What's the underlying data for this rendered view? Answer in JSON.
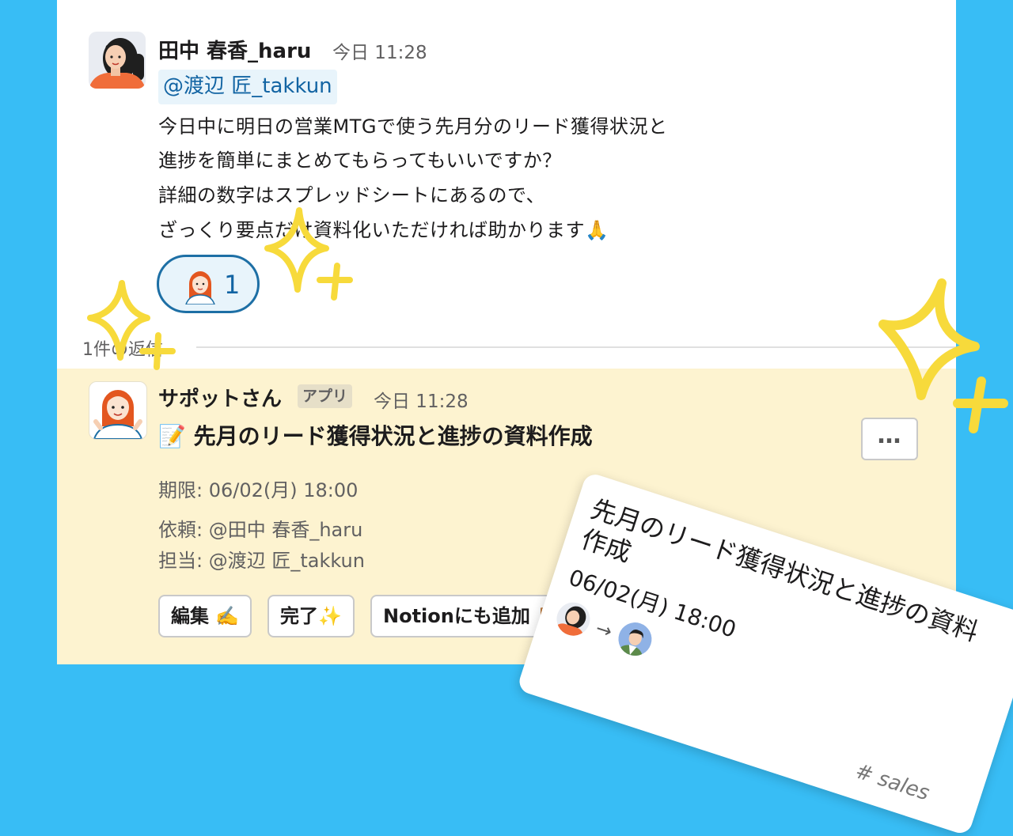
{
  "message": {
    "author": "田中 春香_haru",
    "time": "今日 11:28",
    "mention": "@渡辺 匠_takkun",
    "lines": [
      "今日中に明日の営業MTGで使う先月分のリード獲得状況と",
      "進捗を簡単にまとめてもらってもいいですか？",
      "詳細の数字はスプレッドシートにあるので、",
      "ざっくり要点だけ資料化いただければ助かります🙏"
    ],
    "reaction_count": "1"
  },
  "thread": {
    "replies_label": "1件の返信"
  },
  "bot": {
    "name": "サポットさん",
    "badge": "アプリ",
    "time": "今日 11:28",
    "title_icon": "📝",
    "title": "先月のリード獲得状況と進捗の資料作成",
    "deadline": "期限: 06/02(月) 18:00",
    "requester": "依頼: @田中 春香_haru",
    "assignee": "担当: @渡辺 匠_takkun",
    "more_label": "…",
    "buttons": {
      "edit": "編集 ✍️",
      "done": "完了✨",
      "notion": "Notionにも追加 📋"
    }
  },
  "card": {
    "title": "先月のリード獲得状況と進捗の資料作成",
    "date": "06/02(月) 18:00",
    "arrow": "→",
    "channel": "# sales"
  },
  "colors": {
    "background": "#38BDF5",
    "bot_bg": "#FDF3D0",
    "link": "#1264A3",
    "sparkle": "#F7DA3B"
  }
}
